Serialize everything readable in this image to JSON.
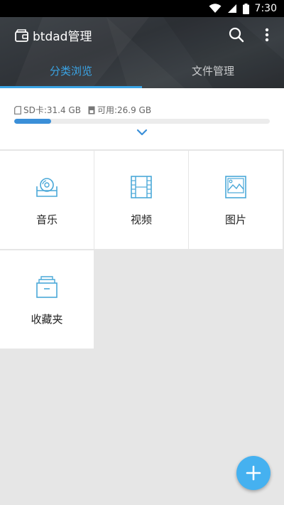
{
  "status_bar": {
    "time": "7:30"
  },
  "app": {
    "title": "btdad管理",
    "accent_color": "#3aa4e5"
  },
  "toolbar": {
    "search_icon": "search-icon",
    "more_icon": "more-vert-icon"
  },
  "tabs": [
    {
      "label": "分类浏览",
      "active": true
    },
    {
      "label": "文件管理",
      "active": false
    }
  ],
  "storage": {
    "sd_label": "SD卡:31.4 GB",
    "available_label": "可用:26.9 GB",
    "used_fraction": 0.145
  },
  "categories": [
    {
      "label": "音乐",
      "icon": "music-disc-icon"
    },
    {
      "label": "视频",
      "icon": "film-icon"
    },
    {
      "label": "图片",
      "icon": "picture-icon"
    },
    {
      "label": "收藏夹",
      "icon": "favorites-box-icon"
    }
  ],
  "fab": {
    "icon": "plus-icon"
  }
}
